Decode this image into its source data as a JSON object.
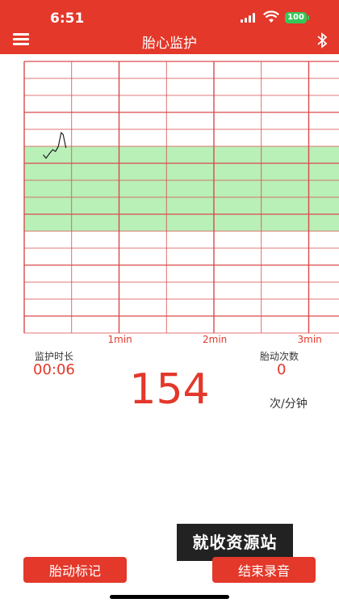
{
  "status_bar": {
    "time": "6:51",
    "battery": "100"
  },
  "header": {
    "title": "胎心监护"
  },
  "chart_data": {
    "type": "line",
    "title": "",
    "xlabel": "",
    "ylabel": "",
    "x_ticks": [
      {
        "minute": 1,
        "label": "1min"
      },
      {
        "minute": 2,
        "label": "2min"
      },
      {
        "minute": 3,
        "label": "3min"
      }
    ],
    "xlim_minutes": [
      0,
      3.0
    ],
    "normal_band_color": "#b8f0b8",
    "grid_color": "#d94a4a",
    "series": [
      {
        "color": "#111111",
        "points": [
          [
            0.2,
            155
          ],
          [
            0.23,
            153
          ],
          [
            0.27,
            156
          ],
          [
            0.3,
            158
          ],
          [
            0.33,
            157
          ],
          [
            0.36,
            160
          ],
          [
            0.39,
            168
          ],
          [
            0.41,
            167
          ],
          [
            0.44,
            159
          ]
        ]
      }
    ]
  },
  "stats": {
    "duration_label": "监护时长",
    "duration_value": "00:06",
    "fetal_movement_label": "胎动次数",
    "fetal_movement_value": "0",
    "fhr_value": "154",
    "fhr_unit": "次/分钟"
  },
  "watermark": "就收资源站",
  "actions": {
    "mark_label": "胎动标记",
    "stop_label": "结束录音"
  },
  "colors": {
    "primary": "#e3382a",
    "status_green": "#35c759"
  }
}
